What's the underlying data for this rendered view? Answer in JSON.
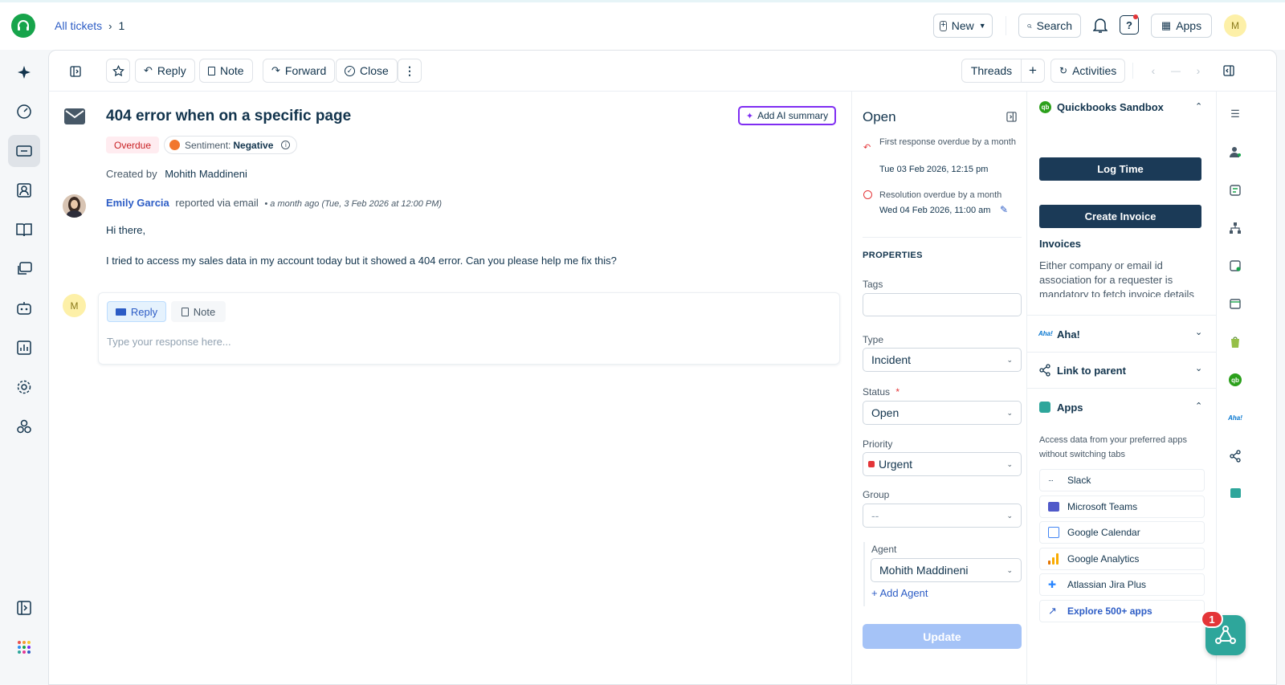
{
  "header": {
    "breadcrumb_root": "All tickets",
    "breadcrumb_current": "1",
    "new_label": "New",
    "search_label": "Search",
    "apps_label": "Apps",
    "avatar_initial": "M"
  },
  "toolbar": {
    "reply_label": "Reply",
    "note_label": "Note",
    "forward_label": "Forward",
    "close_label": "Close",
    "threads_label": "Threads",
    "activities_label": "Activities"
  },
  "ticket": {
    "title": "404 error when on a specific page",
    "ai_summary_label": "Add AI summary",
    "overdue_label": "Overdue",
    "sentiment_prefix": "Sentiment:",
    "sentiment_value": "Negative",
    "created_by_prefix": "Created by",
    "created_by_name": "Mohith Maddineni",
    "requester_name": "Emily Garcia",
    "reported_via": "reported via email",
    "time_info": "• a month ago (Tue, 3 Feb 2026 at 12:00 PM)",
    "greeting": "Hi there,",
    "body": "I tried to access my sales data in my account today but it showed a 404 error. Can you please help me fix this?"
  },
  "composer": {
    "avatar_initial": "M",
    "reply_tab": "Reply",
    "note_tab": "Note",
    "placeholder": "Type your response here..."
  },
  "properties": {
    "status_heading": "Open",
    "first_response_text": "First response overdue by a month",
    "first_response_date": "Tue 03 Feb 2026, 12:15 pm",
    "resolution_text": "Resolution overdue by a month",
    "resolution_date": "Wed 04 Feb 2026, 11:00 am",
    "section_title": "PROPERTIES",
    "tags_label": "Tags",
    "type_label": "Type",
    "type_value": "Incident",
    "status_label": "Status",
    "required_mark": "*",
    "status_value": "Open",
    "priority_label": "Priority",
    "priority_value": "Urgent",
    "group_label": "Group",
    "group_value": "--",
    "agent_label": "Agent",
    "agent_value": "Mohith Maddineni",
    "add_agent": "+ Add Agent",
    "update_label": "Update"
  },
  "apps_panel": {
    "quickbooks_title": "Quickbooks Sandbox",
    "log_time": "Log Time",
    "create_invoice": "Create Invoice",
    "invoices_heading": "Invoices",
    "invoices_text": "Either company or email id association for a requester is mandatory to fetch invoice details",
    "aha_title": "Aha!",
    "aha_logo_text": "Aha!",
    "link_parent_title": "Link to parent",
    "apps_title": "Apps",
    "apps_desc": "Access data from your preferred apps without switching tabs",
    "app_list": [
      "Slack",
      "Microsoft Teams",
      "Google Calendar",
      "Google Analytics",
      "Atlassian Jira Plus"
    ],
    "explore": "Explore 500+ apps",
    "notification_count": "1"
  },
  "colors": {
    "brand_green": "#17a44b",
    "link_blue": "#2c5cc5",
    "dark_button": "#1b3a57",
    "overdue_bg": "#ffecf0",
    "overdue_text": "#c82124",
    "urgent_red": "#e43538",
    "update_disabled": "#a5c3f7",
    "ai_purple": "#7f2df2",
    "fab_teal": "#2ea69b"
  }
}
